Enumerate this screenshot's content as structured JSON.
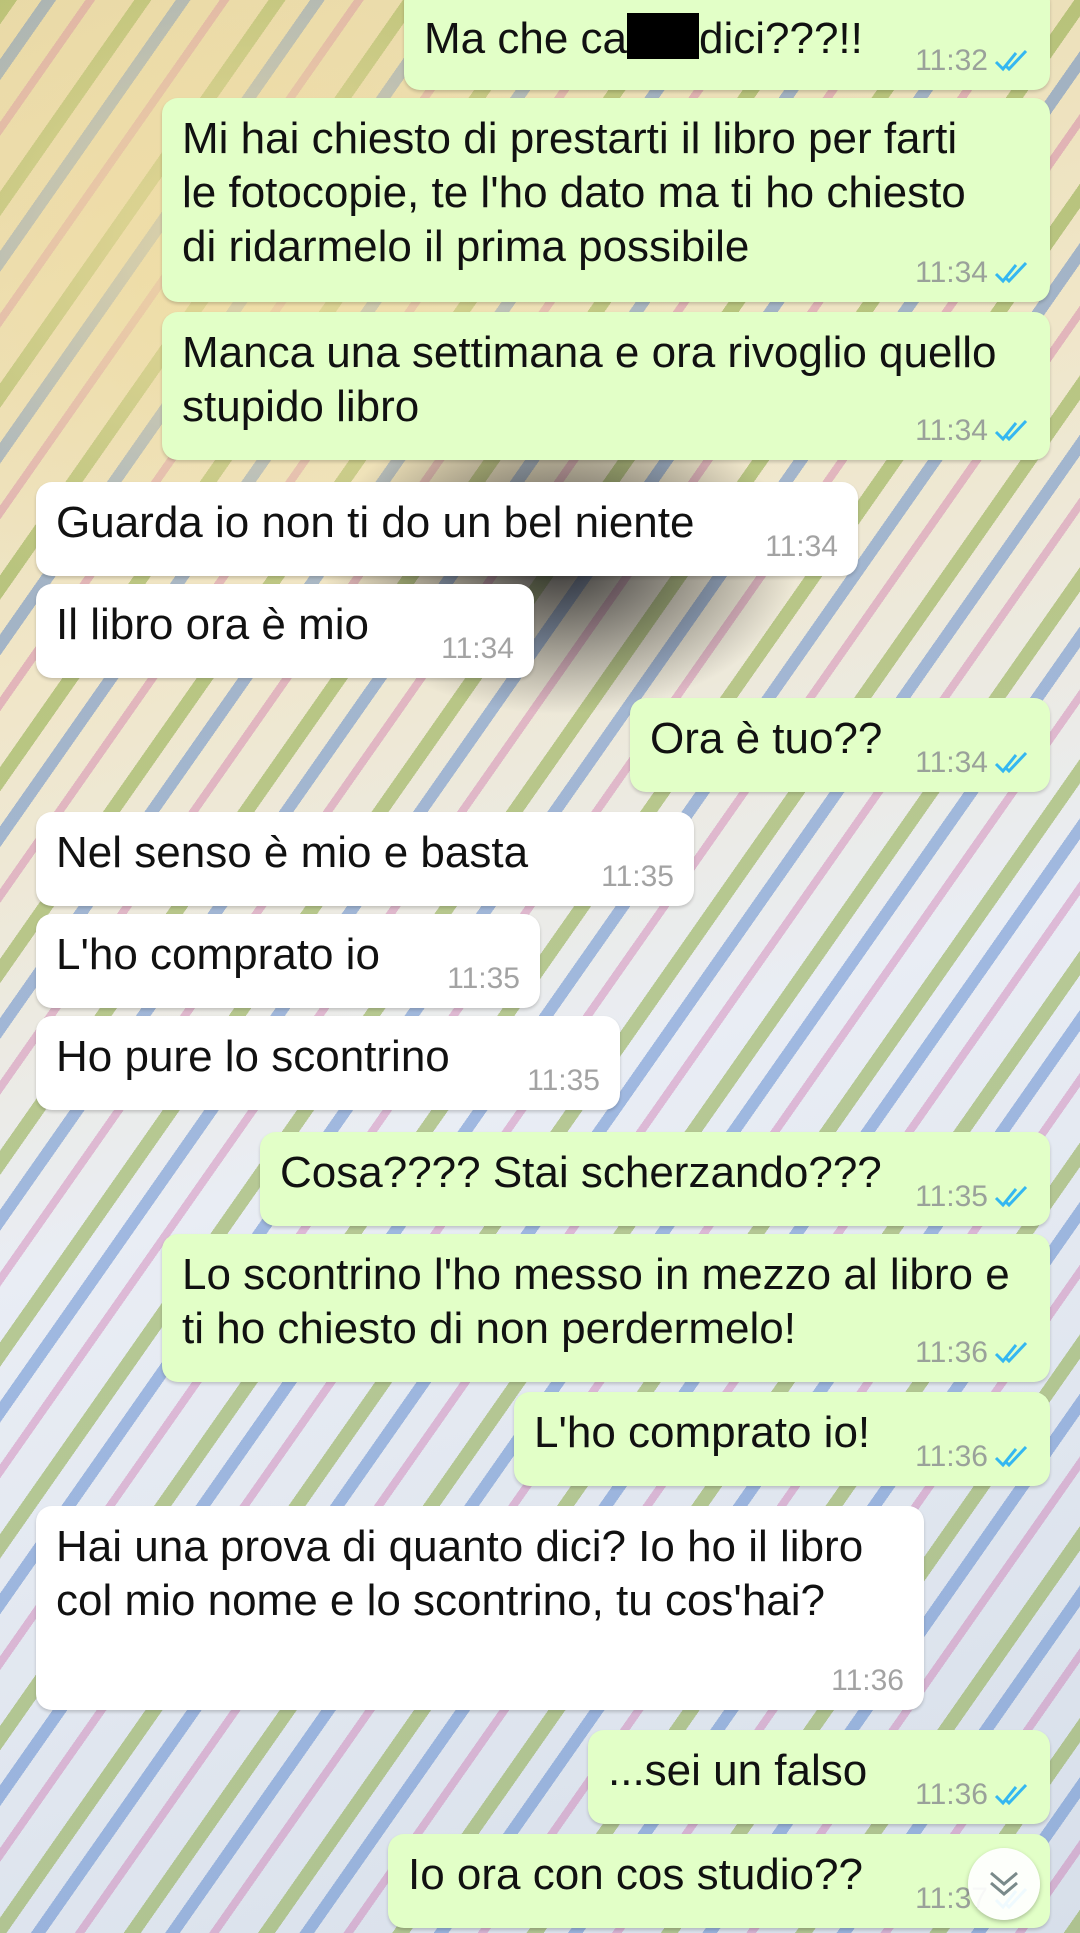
{
  "messages": [
    {
      "dir": "out",
      "text_before": "Ma che ca",
      "text_after": "dici???!!",
      "time": "11:32",
      "ticks": "read-double-check-icon"
    },
    {
      "dir": "out",
      "text": "Mi hai chiesto di prestarti il libro per farti le fotocopie, te l'ho dato ma ti ho chiesto di ridarmelo il prima possibile",
      "time": "11:34"
    },
    {
      "dir": "out",
      "text": "Manca una settimana e ora rivoglio quello stupido libro",
      "time": "11:34"
    },
    {
      "dir": "in",
      "text": "Guarda io non ti do un bel niente",
      "time": "11:34"
    },
    {
      "dir": "in",
      "text": "Il libro ora è mio",
      "time": "11:34"
    },
    {
      "dir": "out",
      "text": "Ora è tuo??",
      "time": "11:34"
    },
    {
      "dir": "in",
      "text": "Nel senso è mio e basta",
      "time": "11:35"
    },
    {
      "dir": "in",
      "text": "L'ho comprato io",
      "time": "11:35"
    },
    {
      "dir": "in",
      "text": "Ho pure lo scontrino",
      "time": "11:35"
    },
    {
      "dir": "out",
      "text": "Cosa???? Stai scherzando???",
      "time": "11:35"
    },
    {
      "dir": "out",
      "text": "Lo scontrino l'ho messo in mezzo al libro e ti ho chiesto di non perdermelo!",
      "time": "11:36"
    },
    {
      "dir": "out",
      "text": "L'ho comprato io!",
      "time": "11:36"
    },
    {
      "dir": "in",
      "text": "Hai una prova di quanto dici? Io ho il libro col mio nome e lo scontrino, tu cos'hai?",
      "time": "11:36"
    },
    {
      "dir": "out",
      "text": "...sei un falso",
      "time": "11:36"
    },
    {
      "dir": "out",
      "text": "Io ora con cos studio??",
      "time": "11:37"
    }
  ],
  "colors": {
    "outgoing_bubble": "#e2ffc7",
    "incoming_bubble": "#ffffff",
    "read_ticks": "#34b7f1"
  },
  "icons": {
    "read_receipt": "double-check-icon",
    "scroll_down": "chevron-down-icon"
  }
}
